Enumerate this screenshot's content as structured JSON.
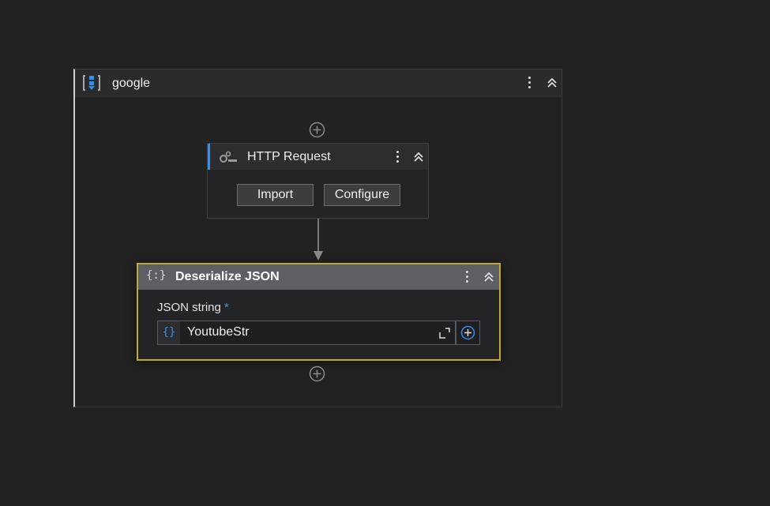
{
  "sequence": {
    "title": "google",
    "icon": "sequence-icon",
    "menu_icon": "more-vertical-icon",
    "collapse_icon": "chevron-double-up-icon"
  },
  "add_activity": {
    "icon": "add-circle-icon"
  },
  "http_request": {
    "title": "HTTP Request",
    "icon": "http-request-icon",
    "accent_color": "#3b8fe0",
    "buttons": {
      "import": "Import",
      "configure": "Configure"
    }
  },
  "deserialize_json": {
    "title": "Deserialize JSON",
    "icon_text": "{:}",
    "border_color": "#c2a731",
    "field": {
      "label": "JSON string",
      "required_mark": "*",
      "prefix": "{}",
      "value": "YoutubeStr",
      "expand_icon": "expand-icon",
      "add_icon": "add-variable-icon"
    }
  }
}
